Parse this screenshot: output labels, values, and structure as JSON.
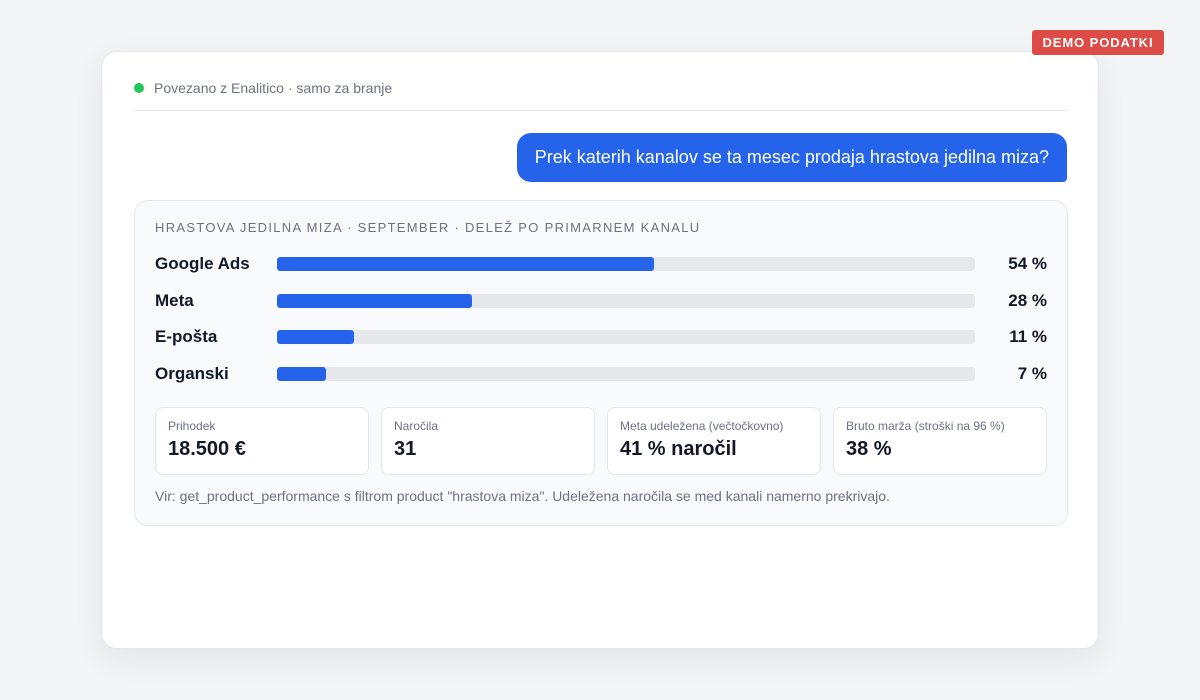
{
  "badge": {
    "label": "DEMO PODATKI",
    "color": "#dc4b45"
  },
  "status": {
    "text": "Povezano z Enalitico · samo za branje",
    "dot_color": "#22c55e"
  },
  "user_message": {
    "text": "Prek katerih kanalov se ta mesec prodaja hrastova jedilna miza?"
  },
  "result": {
    "caption": "HRASTOVA JEDILNA MIZA · SEPTEMBER · DELEŽ PO PRIMARNEM KANALU",
    "channels": [
      {
        "name": "Google Ads",
        "value_label": "54 %",
        "share": 0.54
      },
      {
        "name": "Meta",
        "value_label": "28 %",
        "share": 0.28
      },
      {
        "name": "E-pošta",
        "value_label": "11 %",
        "share": 0.11
      },
      {
        "name": "Organski",
        "value_label": "7 %",
        "share": 0.07
      }
    ],
    "stats": [
      {
        "label": "Prihodek",
        "value": "18.500 €"
      },
      {
        "label": "Naročila",
        "value": "31"
      },
      {
        "label": "Meta udeležena (večtočkovno)",
        "value": "41 % naročil"
      },
      {
        "label": "Bruto marža (stroški na 96 %)",
        "value": "38 %"
      }
    ],
    "source_note": "Vir: get_product_performance s filtrom product \"hrastova miza\". Udeležena naročila se med kanali namerno prekrivajo."
  },
  "colors": {
    "accent": "#2563eb",
    "track": "#e5e7eb"
  }
}
